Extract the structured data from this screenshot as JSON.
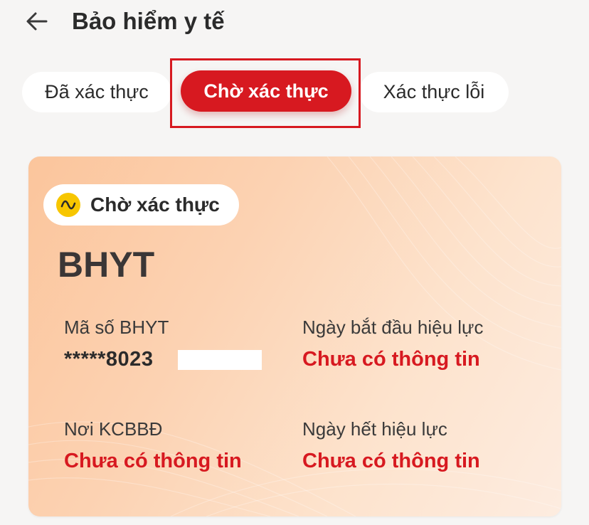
{
  "header": {
    "title": "Bảo hiểm y tế",
    "back_icon": "arrow-left-icon"
  },
  "tabs": [
    {
      "label": "Đã xác thực",
      "selected": false
    },
    {
      "label": "Chờ xác thực",
      "selected": true
    },
    {
      "label": "Xác thực lỗi",
      "selected": false
    }
  ],
  "colors": {
    "accent": "#d71920",
    "status_icon": "#f7c600",
    "card_gradient_start": "#fbc59c",
    "card_gradient_end": "#fdece0"
  },
  "card": {
    "status_icon": "pending-wave-icon",
    "status": "Chờ xác thực",
    "type": "BHYT",
    "fields": {
      "policy_number": {
        "label": "Mã số BHYT",
        "value": "*****8023"
      },
      "start_date": {
        "label": "Ngày bắt đầu hiệu lực",
        "value": "Chưa có thông tin"
      },
      "facility": {
        "label": "Nơi KCBBĐ",
        "value": "Chưa có thông tin"
      },
      "end_date": {
        "label": "Ngày hết hiệu lực",
        "value": "Chưa có thông tin"
      }
    }
  }
}
